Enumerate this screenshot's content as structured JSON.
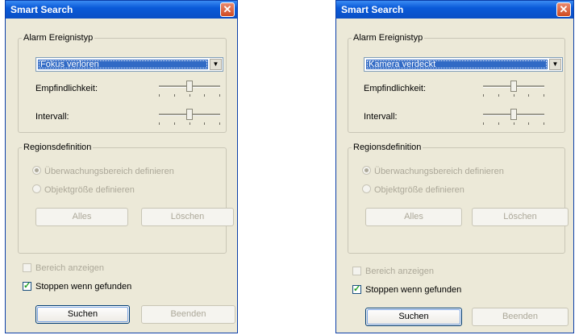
{
  "dialogs": [
    {
      "title": "Smart Search",
      "close_glyph": "✕",
      "alarm_group": "Alarm Ereignistyp",
      "alarm_type": "Fokus verloren",
      "dropdown_arrow": "▼",
      "sensitivity_label": "Empfindlichkeit:",
      "sensitivity_level": 0.5,
      "interval_label": "Intervall:",
      "interval_level": 0.5,
      "region_group": "Regionsdefinition",
      "radio_monitor": "Überwachungsbereich definieren",
      "radio_object": "Objektgröße definieren",
      "btn_all": "Alles",
      "btn_delete": "Löschen",
      "show_area": "Bereich anzeigen",
      "stop_when_found": "Stoppen wenn gefunden",
      "btn_search": "Suchen",
      "btn_finish": "Beenden"
    },
    {
      "title": "Smart Search",
      "close_glyph": "✕",
      "alarm_group": "Alarm Ereignistyp",
      "alarm_type": "Kamera verdeckt",
      "dropdown_arrow": "▼",
      "sensitivity_label": "Empfindlichkeit:",
      "sensitivity_level": 0.5,
      "interval_label": "Intervall:",
      "interval_level": 0.5,
      "region_group": "Regionsdefinition",
      "radio_monitor": "Überwachungsbereich definieren",
      "radio_object": "Objektgröße definieren",
      "btn_all": "Alles",
      "btn_delete": "Löschen",
      "show_area": "Bereich anzeigen",
      "stop_when_found": "Stoppen wenn gefunden",
      "btn_search": "Suchen",
      "btn_finish": "Beenden"
    }
  ]
}
